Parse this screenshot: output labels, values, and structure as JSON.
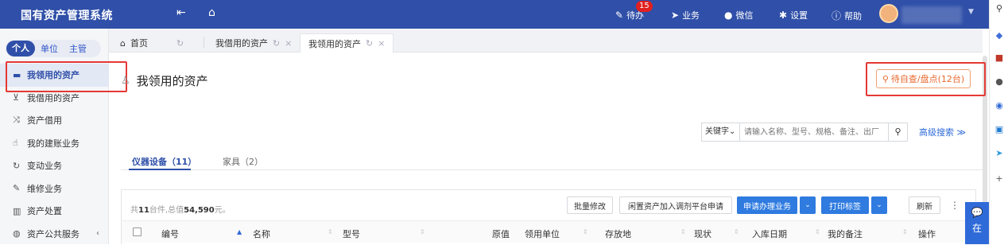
{
  "topbar": {
    "brand": "国有资产管理系统",
    "todo_label": "待办",
    "todo_count": "15",
    "business_label": "业务",
    "wechat_label": "微信",
    "settings_label": "设置",
    "help_label": "帮助"
  },
  "sidebar": {
    "segments": [
      "个人",
      "单位",
      "主管"
    ],
    "items": [
      {
        "label": "我领用的资产",
        "icon": "desk-icon"
      },
      {
        "label": "我借用的资产",
        "icon": "inbox-icon"
      },
      {
        "label": "资产借用",
        "icon": "shuffle-icon"
      },
      {
        "label": "我的建账业务",
        "icon": "thumb-icon"
      },
      {
        "label": "变动业务",
        "icon": "refresh-icon"
      },
      {
        "label": "维修业务",
        "icon": "wrench-icon"
      },
      {
        "label": "资产处置",
        "icon": "trash-icon"
      },
      {
        "label": "资产公共服务",
        "icon": "globe-icon"
      }
    ]
  },
  "tabs": {
    "home": "首页",
    "borrowed": "我借用的资产",
    "received": "我领用的资产"
  },
  "main": {
    "title": "我领用的资产",
    "check_button": "待自查/盘点(12台)",
    "search": {
      "keyword_label": "关键字",
      "placeholder": "请输入名称、型号、规格、备注、出厂",
      "advanced": "高级搜索"
    },
    "content_tabs": [
      "仪器设备（11）",
      "家具（2）"
    ],
    "summary": {
      "prefix": "共",
      "count": "11",
      "mid": "台件,总值",
      "total": "54,590",
      "suffix": "元。"
    },
    "buttons": {
      "batch_edit": "批量修改",
      "idle_add": "闲置资产加入调剂平台申请",
      "apply_business": "申请办理业务",
      "print_label": "打印标签",
      "refresh": "刷新"
    },
    "columns": [
      "编号",
      "名称",
      "型号",
      "原值",
      "领用单位",
      "存放地",
      "现状",
      "入库日期",
      "我的备注",
      "操作"
    ]
  },
  "float_chat_label": "在"
}
